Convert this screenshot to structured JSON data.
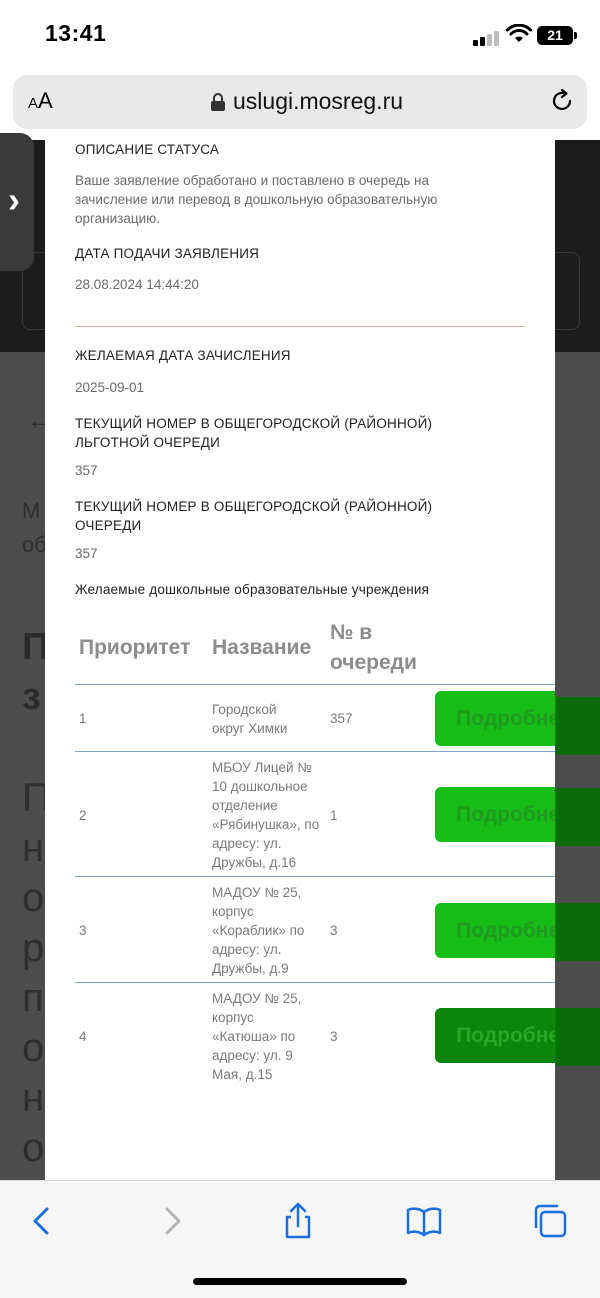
{
  "status_bar": {
    "time": "13:41",
    "battery": "21"
  },
  "browser": {
    "text_size_label_small": "A",
    "text_size_label_large": "A",
    "url": "uslugi.mosreg.ru"
  },
  "modal": {
    "status_description_label": "ОПИСАНИЕ СТАТУСА",
    "status_description": "Ваше заявление обработано и поставлено в очередь на зачисление или перевод в дошкольную образовательную организацию.",
    "submission_date_label": "ДАТА ПОДАЧИ ЗАЯВЛЕНИЯ",
    "submission_date": "28.08.2024 14:44:20",
    "desired_date_label": "ЖЕЛАЕМАЯ ДАТА ЗАЧИСЛЕНИЯ",
    "desired_date": "2025-09-01",
    "privileged_queue_label": "ТЕКУЩИЙ НОМЕР В ОБЩЕГОРОДСКОЙ (РАЙОННОЙ) ЛЬГОТНОЙ ОЧЕРЕДИ",
    "privileged_queue_number": "357",
    "general_queue_label": "ТЕКУЩИЙ НОМЕР В ОБЩЕГОРОДСКОЙ (РАЙОННОЙ) ОЧЕРЕДИ",
    "general_queue_number": "357",
    "institutions_label": "Желаемые дошкольные образовательные учреждения",
    "table": {
      "headers": {
        "priority": "Приоритет",
        "name": "Название",
        "queue_number": "№ в очереди"
      },
      "rows": [
        {
          "priority": "1",
          "name": "Городской округ Химки",
          "queue_number": "357",
          "details_label": "Подробнее"
        },
        {
          "priority": "2",
          "name": "МБОУ Лицей № 10 дошкольное отделение «Рябинушка», по адресу: ул. Дружбы, д.16",
          "queue_number": "1",
          "details_label": "Подробнее"
        },
        {
          "priority": "3",
          "name": "МАДОУ № 25, корпус «Кораблик» по адресу: ул. Дружбы, д.9",
          "queue_number": "3",
          "details_label": "Подробнее"
        },
        {
          "priority": "4",
          "name": "МАДОУ № 25, корпус «Катюша» по адресу: ул. 9 Мая, д.15",
          "queue_number": "3",
          "details_label": "Подробнее"
        }
      ]
    }
  },
  "colors": {
    "button_green": "#17bd17",
    "button_green_active": "#0b850b",
    "divider": "#e8a6a0",
    "row_line": "#7fa7c8"
  },
  "icons": [
    "lock-icon",
    "reload-icon",
    "back-icon",
    "forward-icon",
    "share-icon",
    "bookmarks-icon",
    "tabs-icon"
  ]
}
